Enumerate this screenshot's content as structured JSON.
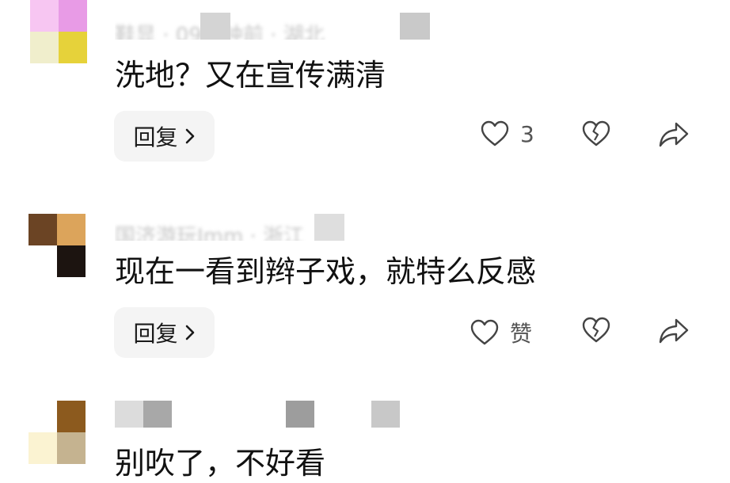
{
  "comments": [
    {
      "author": "鞋显 · 09分钟前 · 湖北",
      "text": "洗地？又在宣传满清",
      "reply_label": "回复",
      "like_label": "3",
      "avatar_colors": [
        "#e89be6",
        "#e6d23a",
        "#f7c6f2",
        "#f0eecc"
      ]
    },
    {
      "author": "国济游玩Jmm · 浙江",
      "text": "现在一看到辫子戏，就特么反感",
      "reply_label": "回复",
      "like_label": "赞",
      "avatar_colors": [
        "#6b4424",
        "#dca45b",
        "#ffffff",
        "#1c1410"
      ]
    },
    {
      "author": "",
      "text": "别吹了，不好看",
      "reply_label": "",
      "like_label": "",
      "avatar_colors": [
        "#ffffff",
        "#8c5a1e",
        "#fbf3d2",
        "#c5b390"
      ]
    }
  ],
  "icons": {
    "heart": "heart-icon",
    "dislike": "broken-heart-icon",
    "share": "share-icon",
    "chevron": "chevron-right-icon"
  },
  "colors": {
    "text": "#111111",
    "muted": "#555555",
    "button_bg": "#f4f4f4",
    "icon_stroke": "#444444"
  }
}
